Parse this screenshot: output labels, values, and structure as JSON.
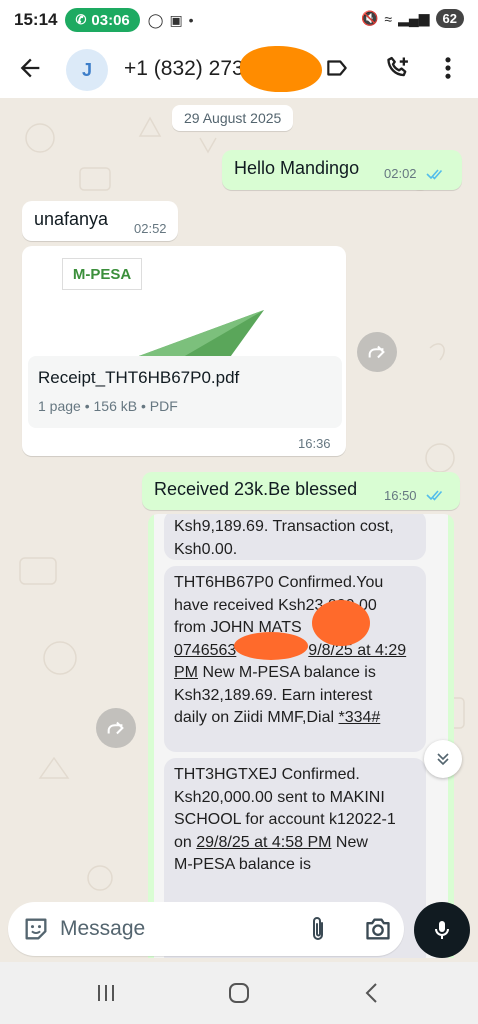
{
  "status_bar": {
    "time": "15:14",
    "call_timer": "03:06",
    "battery": "62"
  },
  "header": {
    "avatar_letter": "J",
    "contact_name": "+1 (832) 273"
  },
  "chat": {
    "date_chip": "29 August 2025",
    "messages": [
      {
        "type": "outgoing",
        "text": "Hello Mandingo",
        "time": "02:02",
        "read": true
      },
      {
        "type": "incoming",
        "text": "unafanya",
        "time": "02:52"
      },
      {
        "type": "incoming-document",
        "logo_text": "M-PESA",
        "filename": "Receipt_THT6HB67P0.pdf",
        "meta": "1 page • 156 kB • PDF",
        "time": "16:36"
      },
      {
        "type": "outgoing",
        "text": "Received 23k.Be blessed",
        "time": "16:50",
        "read": true
      }
    ],
    "screenshot_sms": {
      "sms0_line1": "Ksh9,189.69. Transaction cost,",
      "sms0_line2": "Ksh0.00.",
      "sms1_line1": "THT6HB67P0 Confirmed.You",
      "sms1_line2": "have received Ksh23,000.00",
      "sms1_line3": "from JOHN  MATS",
      "sms1_line4a": "0746563",
      "sms1_line4b": "9/8/25 at 4:29",
      "sms1_line5a": "PM",
      "sms1_line5b": " New M-PESA balance is",
      "sms1_line6": "Ksh32,189.69. Earn interest",
      "sms1_line7a": "daily on Ziidi MMF,Dial ",
      "sms1_line7b": "*334#",
      "sms2_line1": "THT3HGTXEJ Confirmed.",
      "sms2_line2": "Ksh20,000.00 sent to MAKINI",
      "sms2_line3": "SCHOOL for account k12022-1",
      "sms2_line4a": "on ",
      "sms2_line4b": "29/8/25 at 4:58 PM",
      "sms2_line4c": " New",
      "sms2_line5": "M-PESA balance is"
    }
  },
  "input_bar": {
    "placeholder": "Message"
  },
  "colors": {
    "outgoing_bubble": "#d9fdd3",
    "incoming_bubble": "#ffffff",
    "read_ticks": "#53bdeb",
    "call_pill": "#1daa61",
    "redaction": "#ff8c00",
    "mic_button": "#111b21"
  },
  "icons": [
    "back-arrow-icon",
    "label-icon",
    "add-call-icon",
    "more-vert-icon",
    "forward-icon",
    "double-chevron-down-icon",
    "sticker-icon",
    "paperclip-icon",
    "camera-icon",
    "mic-icon",
    "nav-recents-icon",
    "nav-home-icon",
    "nav-back-icon"
  ]
}
